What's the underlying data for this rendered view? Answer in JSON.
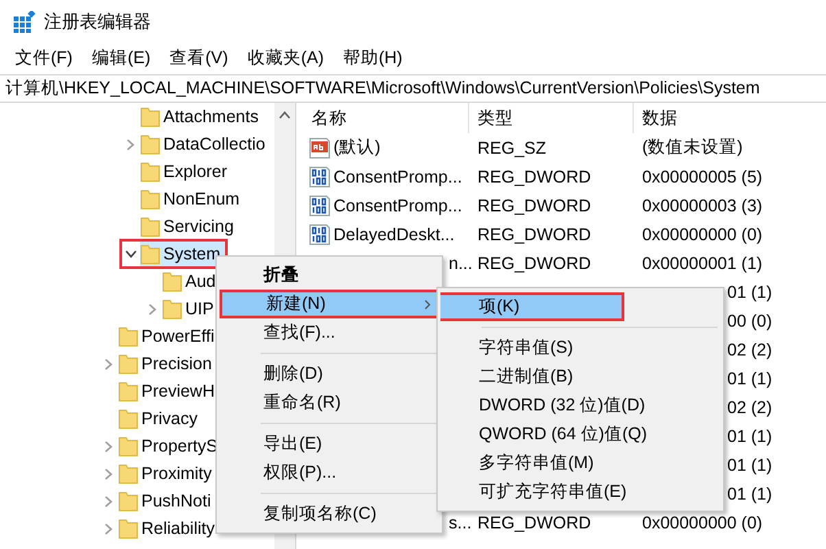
{
  "window": {
    "title": "注册表编辑器"
  },
  "menu_bar": [
    "文件(F)",
    "编辑(E)",
    "查看(V)",
    "收藏夹(A)",
    "帮助(H)"
  ],
  "address": "计算机\\HKEY_LOCAL_MACHINE\\SOFTWARE\\Microsoft\\Windows\\CurrentVersion\\Policies\\System",
  "tree": {
    "items": [
      {
        "children": [
          {
            "label": "Attachments",
            "has_children": false,
            "selected": false,
            "highlighted": false
          },
          {
            "label": "DataCollectio",
            "has_children": true,
            "expanded": false,
            "selected": false,
            "highlighted": false
          },
          {
            "label": "Explorer",
            "has_children": false,
            "selected": false,
            "highlighted": false
          },
          {
            "label": "NonEnum",
            "has_children": false,
            "selected": false,
            "highlighted": false
          },
          {
            "label": "Servicing",
            "has_children": false,
            "selected": false,
            "highlighted": false
          },
          {
            "label": "System",
            "has_children": true,
            "expanded": true,
            "selected": true,
            "highlighted": true,
            "children": [
              {
                "label": "Aud",
                "has_children": false,
                "selected": false,
                "highlighted": false
              },
              {
                "label": "UIP",
                "has_children": true,
                "expanded": false,
                "selected": false,
                "highlighted": false
              }
            ]
          }
        ]
      },
      {
        "label": "PowerEffi",
        "has_children": false,
        "selected": false,
        "highlighted": false
      },
      {
        "label": "Precision",
        "has_children": true,
        "expanded": false,
        "selected": false,
        "highlighted": false
      },
      {
        "label": "PreviewH",
        "has_children": false,
        "selected": false,
        "highlighted": false
      },
      {
        "label": "Privacy",
        "has_children": false,
        "selected": false,
        "highlighted": false
      },
      {
        "label": "PropertyS",
        "has_children": true,
        "expanded": false,
        "selected": false,
        "highlighted": false
      },
      {
        "label": "Proximity",
        "has_children": true,
        "expanded": false,
        "selected": false,
        "highlighted": false
      },
      {
        "label": "PushNoti",
        "has_children": true,
        "expanded": false,
        "selected": false,
        "highlighted": false
      },
      {
        "label": "Reliability",
        "has_children": true,
        "expanded": false,
        "selected": false,
        "highlighted": false
      }
    ]
  },
  "table": {
    "columns": [
      "名称",
      "类型",
      "数据"
    ],
    "rows": [
      {
        "kind": "string",
        "name": "(默认)",
        "type": "REG_SZ",
        "data": "(数值未设置)"
      },
      {
        "kind": "dword",
        "name": "ConsentPromp...",
        "type": "REG_DWORD",
        "data": "0x00000005 (5)"
      },
      {
        "kind": "dword",
        "name": "ConsentPromp...",
        "type": "REG_DWORD",
        "data": "0x00000003 (3)"
      },
      {
        "kind": "dword",
        "name": "DelayedDeskt...",
        "type": "REG_DWORD",
        "data": "0x00000000 (0)"
      },
      {
        "name": "n...",
        "type": "REG_DWORD",
        "data": "0x00000001 (1)"
      },
      {
        "data": "01 (1)"
      },
      {
        "data": "00 (0)"
      },
      {
        "data": "02 (2)"
      },
      {
        "data": "01 (1)"
      },
      {
        "data": "02 (2)"
      },
      {
        "data": "01 (1)"
      },
      {
        "data": "01 (1)"
      },
      {
        "data": "01 (1)"
      },
      {
        "name": "s...",
        "type": "REG_DWORD",
        "data": "0x00000000 (0)"
      }
    ]
  },
  "context_menu": {
    "items": [
      {
        "kind": "item",
        "label": "折叠",
        "bold": true,
        "selected": false,
        "submenu": false,
        "highlighted": false
      },
      {
        "kind": "item",
        "label": "新建(N)",
        "bold": false,
        "selected": true,
        "submenu": true,
        "highlighted": true
      },
      {
        "kind": "item",
        "label": "查找(F)...",
        "bold": false,
        "selected": false,
        "submenu": false,
        "highlighted": false
      },
      {
        "kind": "separator"
      },
      {
        "kind": "item",
        "label": "删除(D)",
        "bold": false,
        "selected": false,
        "submenu": false,
        "highlighted": false
      },
      {
        "kind": "item",
        "label": "重命名(R)",
        "bold": false,
        "selected": false,
        "submenu": false,
        "highlighted": false
      },
      {
        "kind": "separator"
      },
      {
        "kind": "item",
        "label": "导出(E)",
        "bold": false,
        "selected": false,
        "submenu": false,
        "highlighted": false
      },
      {
        "kind": "item",
        "label": "权限(P)...",
        "bold": false,
        "selected": false,
        "submenu": false,
        "highlighted": false
      },
      {
        "kind": "separator"
      },
      {
        "kind": "item",
        "label": "复制项名称(C)",
        "bold": false,
        "selected": false,
        "submenu": false,
        "highlighted": false
      }
    ]
  },
  "submenu": {
    "items": [
      {
        "kind": "item",
        "label": "项(K)",
        "selected": true,
        "highlighted": true
      },
      {
        "kind": "separator"
      },
      {
        "kind": "item",
        "label": "字符串值(S)",
        "selected": false,
        "highlighted": false
      },
      {
        "kind": "item",
        "label": "二进制值(B)",
        "selected": false,
        "highlighted": false
      },
      {
        "kind": "item",
        "label": "DWORD (32 位)值(D)",
        "selected": false,
        "highlighted": false
      },
      {
        "kind": "item",
        "label": "QWORD (64 位)值(Q)",
        "selected": false,
        "highlighted": false
      },
      {
        "kind": "item",
        "label": "多字符串值(M)",
        "selected": false,
        "highlighted": false
      },
      {
        "kind": "item",
        "label": "可扩充字符串值(E)",
        "selected": false,
        "highlighted": false
      }
    ]
  }
}
